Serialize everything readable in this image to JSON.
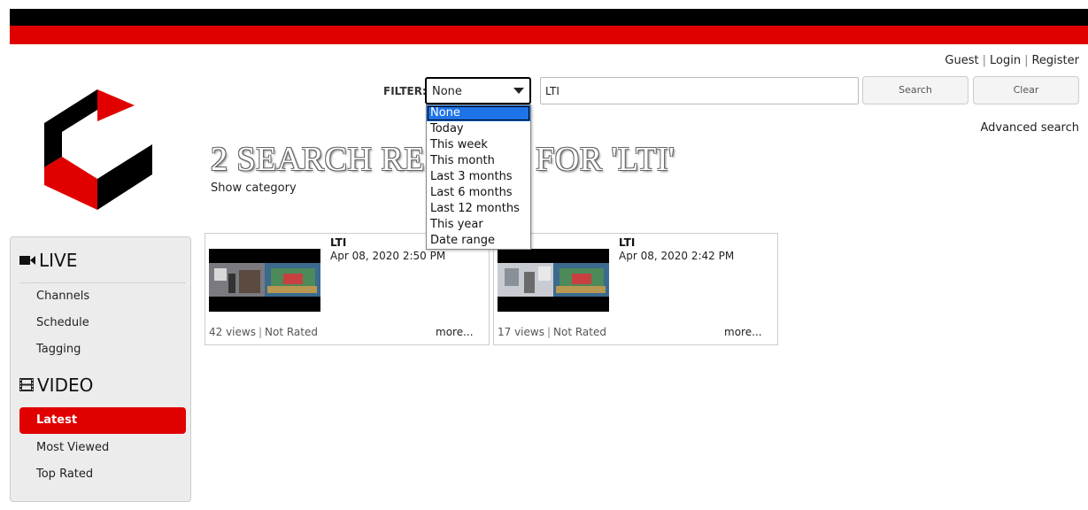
{
  "header": {
    "brand_colors": {
      "black": "#000000",
      "red": "#e00000"
    }
  },
  "user_links": [
    "Guest",
    "Login",
    "Register"
  ],
  "filter": {
    "label": "FILTER:",
    "selected": "None",
    "options": [
      "None",
      "Today",
      "This week",
      "This month",
      "Last 3 months",
      "Last 6 months",
      "Last 12 months",
      "This year",
      "Date range"
    ]
  },
  "search": {
    "value": "LTI",
    "search_label": "Search",
    "clear_label": "Clear",
    "advanced_label": "Advanced search"
  },
  "results": {
    "heading": "2 SEARCH RESULTS FOR 'LTI'",
    "show_category": "Show category"
  },
  "sidebar": {
    "live": {
      "title": "LIVE",
      "icon": "video-camera-icon",
      "items": [
        "Channels",
        "Schedule",
        "Tagging"
      ]
    },
    "video": {
      "title": "VIDEO",
      "icon": "film-icon",
      "active": "Latest",
      "items": [
        "Most Viewed",
        "Top Rated"
      ]
    }
  },
  "cards": [
    {
      "title": "LTI",
      "date": "Apr 08, 2020 2:50 PM",
      "views": "42 views",
      "rating": "Not Rated",
      "more": "more..."
    },
    {
      "title": "LTI",
      "date": "Apr 08, 2020 2:42 PM",
      "views": "17 views",
      "rating": "Not Rated",
      "more": "more..."
    }
  ]
}
